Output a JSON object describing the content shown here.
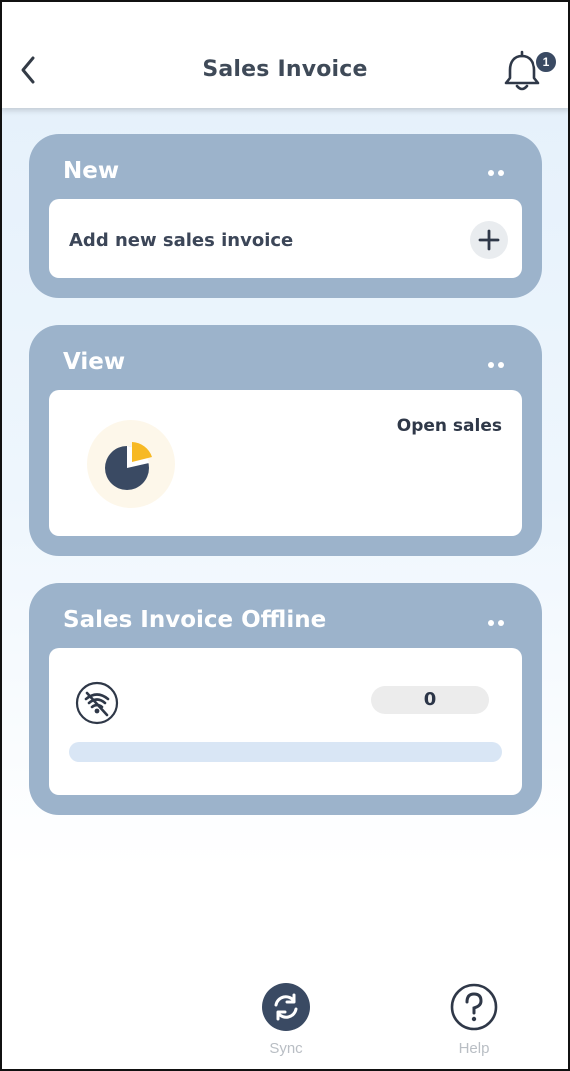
{
  "header": {
    "title": "Sales Invoice",
    "notification_count": "1",
    "back_icon": "chevron-left-icon",
    "bell_icon": "bell-icon"
  },
  "cards": {
    "new": {
      "title": "New",
      "action_label": "Add new sales invoice",
      "action_icon": "plus-icon",
      "menu_icon": "more-dots-icon"
    },
    "view": {
      "title": "View",
      "item_label": "Open sales",
      "item_icon": "pie-chart-icon",
      "menu_icon": "more-dots-icon"
    },
    "offline": {
      "title": "Sales Invoice Offline",
      "count": "0",
      "progress": 0,
      "status_icon": "wifi-off-icon",
      "menu_icon": "more-dots-icon"
    }
  },
  "bottom_nav": {
    "sync": {
      "label": "Sync",
      "icon": "sync-icon"
    },
    "help": {
      "label": "Help",
      "icon": "help-icon"
    }
  },
  "colors": {
    "card_bg": "#9cb3cb",
    "dark_accent": "#3a4a63",
    "pie_accent": "#f7b924",
    "progress_track": "#d9e6f5"
  }
}
